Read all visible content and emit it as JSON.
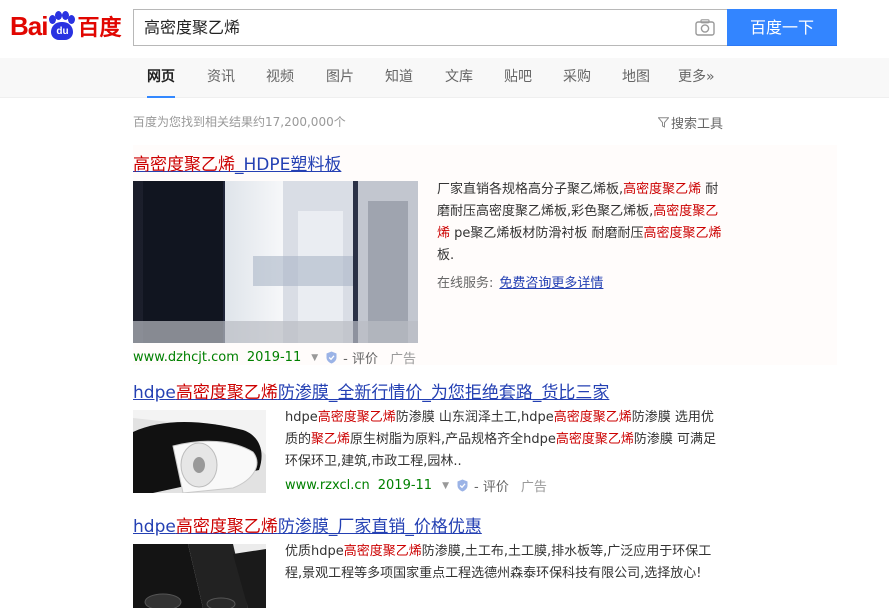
{
  "header": {
    "logo_bai": "Bai",
    "logo_du": "du",
    "logo_cn": "百度",
    "query": "高密度聚乙烯",
    "search_button": "百度一下"
  },
  "tabs": [
    {
      "label": "网页",
      "active": true
    },
    {
      "label": "资讯"
    },
    {
      "label": "视频"
    },
    {
      "label": "图片"
    },
    {
      "label": "知道"
    },
    {
      "label": "文库"
    },
    {
      "label": "贴吧"
    },
    {
      "label": "采购"
    },
    {
      "label": "地图"
    },
    {
      "label": "更多»"
    }
  ],
  "result_count": "百度为您找到相关结果约17,200,000个",
  "search_tools": "搜索工具",
  "results": [
    {
      "title_parts": [
        "高密度聚乙烯",
        "_HDPE塑料板"
      ],
      "abstract_parts": [
        "厂家直销各规格高分子聚乙烯板,",
        "高密度聚乙烯",
        " 耐磨耐压高密度聚乙烯板,彩色聚乙烯板,",
        "高密度聚乙烯",
        " pe聚乙烯板材防滑衬板 耐磨耐压",
        "高密度聚乙烯",
        "板."
      ],
      "online_label": "在线服务:",
      "online_link": "免费咨询更多详情",
      "url": "www.dzhcjt.com",
      "date": "2019-11",
      "eval": "- 评价",
      "ad": "广告"
    },
    {
      "title_parts": [
        "hdpe",
        "高密度聚乙烯",
        "防渗膜_全新行情价_为您拒绝套路_货比三家"
      ],
      "abstract_parts": [
        "hdpe",
        "高密度聚乙烯",
        "防渗膜 山东润泽土工,hdpe",
        "高密度聚乙烯",
        "防渗膜 选用优质的",
        "聚乙烯",
        "原生树脂为原料,产品规格齐全hdpe",
        "高密度聚乙烯",
        "防渗膜 可满足环保环卫,建筑,市政工程,园林.."
      ],
      "url": "www.rzxcl.cn",
      "date": "2019-11",
      "eval": "- 评价",
      "ad": "广告"
    },
    {
      "title_parts": [
        "hdpe",
        "高密度聚乙烯",
        "防渗膜_厂家直销_价格优惠"
      ],
      "abstract_parts": [
        "优质hdpe",
        "高密度聚乙烯",
        "防渗膜,土工布,土工膜,排水板等,广泛应用于环保工程,景观工程等多项国家重点工程选德州森泰环保科技有限公司,选择放心!"
      ]
    }
  ],
  "colors": {
    "link": "#2440b3",
    "highlight": "#cc0000",
    "url_green": "#008000",
    "search_button": "#3385ff"
  }
}
